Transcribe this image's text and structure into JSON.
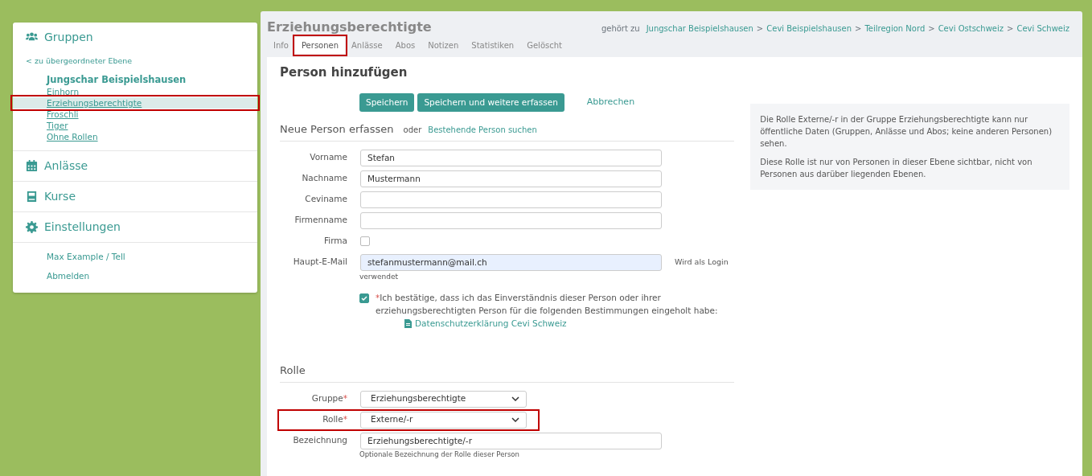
{
  "sidebar": {
    "sections": [
      {
        "kind": "groups",
        "label": "Gruppen",
        "back_link": "< zu übergeordneter Ebene",
        "group_title": "Jungschar Beispielshausen",
        "items": [
          {
            "label": "Einhorn",
            "selected": false,
            "highlighted": false
          },
          {
            "label": "Erziehungsberechtigte",
            "selected": true,
            "highlighted": true
          },
          {
            "label": "Froschli",
            "selected": false,
            "highlighted": false
          },
          {
            "label": "Tiger",
            "selected": false,
            "highlighted": false
          },
          {
            "label": "Ohne Rollen",
            "selected": false,
            "highlighted": false
          }
        ]
      },
      {
        "kind": "events",
        "label": "Anlässe"
      },
      {
        "kind": "courses",
        "label": "Kurse"
      },
      {
        "kind": "settings",
        "label": "Einstellungen"
      }
    ],
    "user_links": [
      "Max Example / Tell",
      "Abmelden"
    ]
  },
  "header": {
    "title": "Erziehungsberechtigte",
    "belongs_to": "gehört zu",
    "breadcrumb_separator": ">",
    "breadcrumbs": [
      "Jungschar Beispielshausen",
      "Cevi Beispielshausen",
      "Teilregion Nord",
      "Cevi Ostschweiz",
      "Cevi Schweiz"
    ],
    "tabs": [
      {
        "label": "Info",
        "selected": false,
        "highlighted": false
      },
      {
        "label": "Personen",
        "selected": true,
        "highlighted": true
      },
      {
        "label": "Anlässe",
        "selected": false,
        "highlighted": false
      },
      {
        "label": "Abos",
        "selected": false,
        "highlighted": false
      },
      {
        "label": "Notizen",
        "selected": false,
        "highlighted": false
      },
      {
        "label": "Statistiken",
        "selected": false,
        "highlighted": false
      },
      {
        "label": "Gelöscht",
        "selected": false,
        "highlighted": false
      }
    ]
  },
  "form": {
    "required_mark": "*",
    "title": "Person hinzufügen",
    "buttons": [
      "Speichern",
      "Speichern und weitere erfassen"
    ],
    "cancel": "Abbrechen",
    "section_title": "Neue Person erfassen",
    "or": "oder",
    "search_link": "Bestehende Person suchen",
    "fields": [
      {
        "kind": "text",
        "label": "Vorname",
        "value": "Stefan"
      },
      {
        "kind": "text",
        "label": "Nachname",
        "value": "Mustermann"
      },
      {
        "kind": "text",
        "label": "Ceviname"
      },
      {
        "kind": "text",
        "label": "Firmenname"
      },
      {
        "kind": "checkbox",
        "label": "Firma",
        "checked": false
      },
      {
        "kind": "email",
        "label": "Haupt-E-Mail",
        "value": "stefanmustermann@mail.ch",
        "hint": "Wird als Login verwendet"
      }
    ],
    "consent": {
      "checked": true,
      "text": "Ich bestätige, dass ich das Einverständnis dieser Person oder ihrer erziehungsberechtigten Person für die folgenden Bestimmungen eingeholt habe:",
      "link": "Datenschutzerklärung Cevi Schweiz"
    },
    "role_title": "Rolle",
    "role_fields": [
      {
        "kind": "select",
        "label": "Gruppe",
        "required": true,
        "value": "Erziehungsberechtigte",
        "highlighted": false
      },
      {
        "kind": "select",
        "label": "Rolle",
        "required": true,
        "value": "Externe/-r",
        "highlighted": true
      },
      {
        "kind": "text",
        "label": "Bezeichnung",
        "required": false,
        "value": "Erziehungsberechtigte/-r",
        "help": "Optionale Bezeichnung der Rolle dieser Person",
        "highlighted": false
      }
    ]
  },
  "info_box": [
    "Die Rolle Externe/-r in der Gruppe Erziehungsberechtigte kann nur öffentliche Daten (Gruppen, Anlässe und Abos; keine anderen Personen) sehen.",
    "Diese Rolle ist nur von Personen in dieser Ebene sichtbar, nicht von Personen aus darüber liegenden Ebenen."
  ]
}
